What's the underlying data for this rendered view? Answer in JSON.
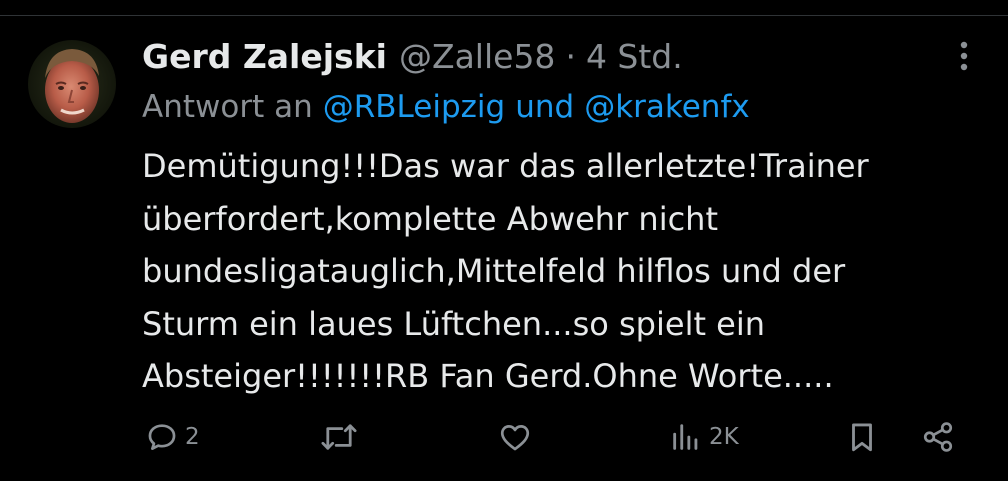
{
  "tweet": {
    "author_name": "Gerd Zalejski",
    "handle": "@Zalle58",
    "separator": "·",
    "time": "4 Std.",
    "reply_prefix": "Antwort an",
    "reply_mentions": [
      "@RBLeipzig",
      "@krakenfx"
    ],
    "reply_joiner": "und",
    "text_lines": [
      "Demütigung!!!Das war das allerletzte!Trainer",
      "überfordert,komplette Abwehr nicht",
      "bundesligatauglich,Mittelfeld hilflos und der",
      "Sturm ein laues Lüftchen...so spielt ein",
      "Absteiger!!!!!!!RB Fan Gerd.Ohne Worte....."
    ]
  },
  "actions": {
    "reply": {
      "icon": "reply-icon",
      "count": "2"
    },
    "retweet": {
      "icon": "retweet-icon"
    },
    "like": {
      "icon": "heart-icon"
    },
    "views": {
      "icon": "views-icon",
      "count": "2K"
    },
    "bookmark": {
      "icon": "bookmark-icon"
    },
    "share": {
      "icon": "share-icon"
    }
  },
  "colors": {
    "background": "#000000",
    "text": "#e7e9ea",
    "secondary": "#8b9095",
    "link": "#1d9bf0",
    "divider": "#2f3336"
  }
}
